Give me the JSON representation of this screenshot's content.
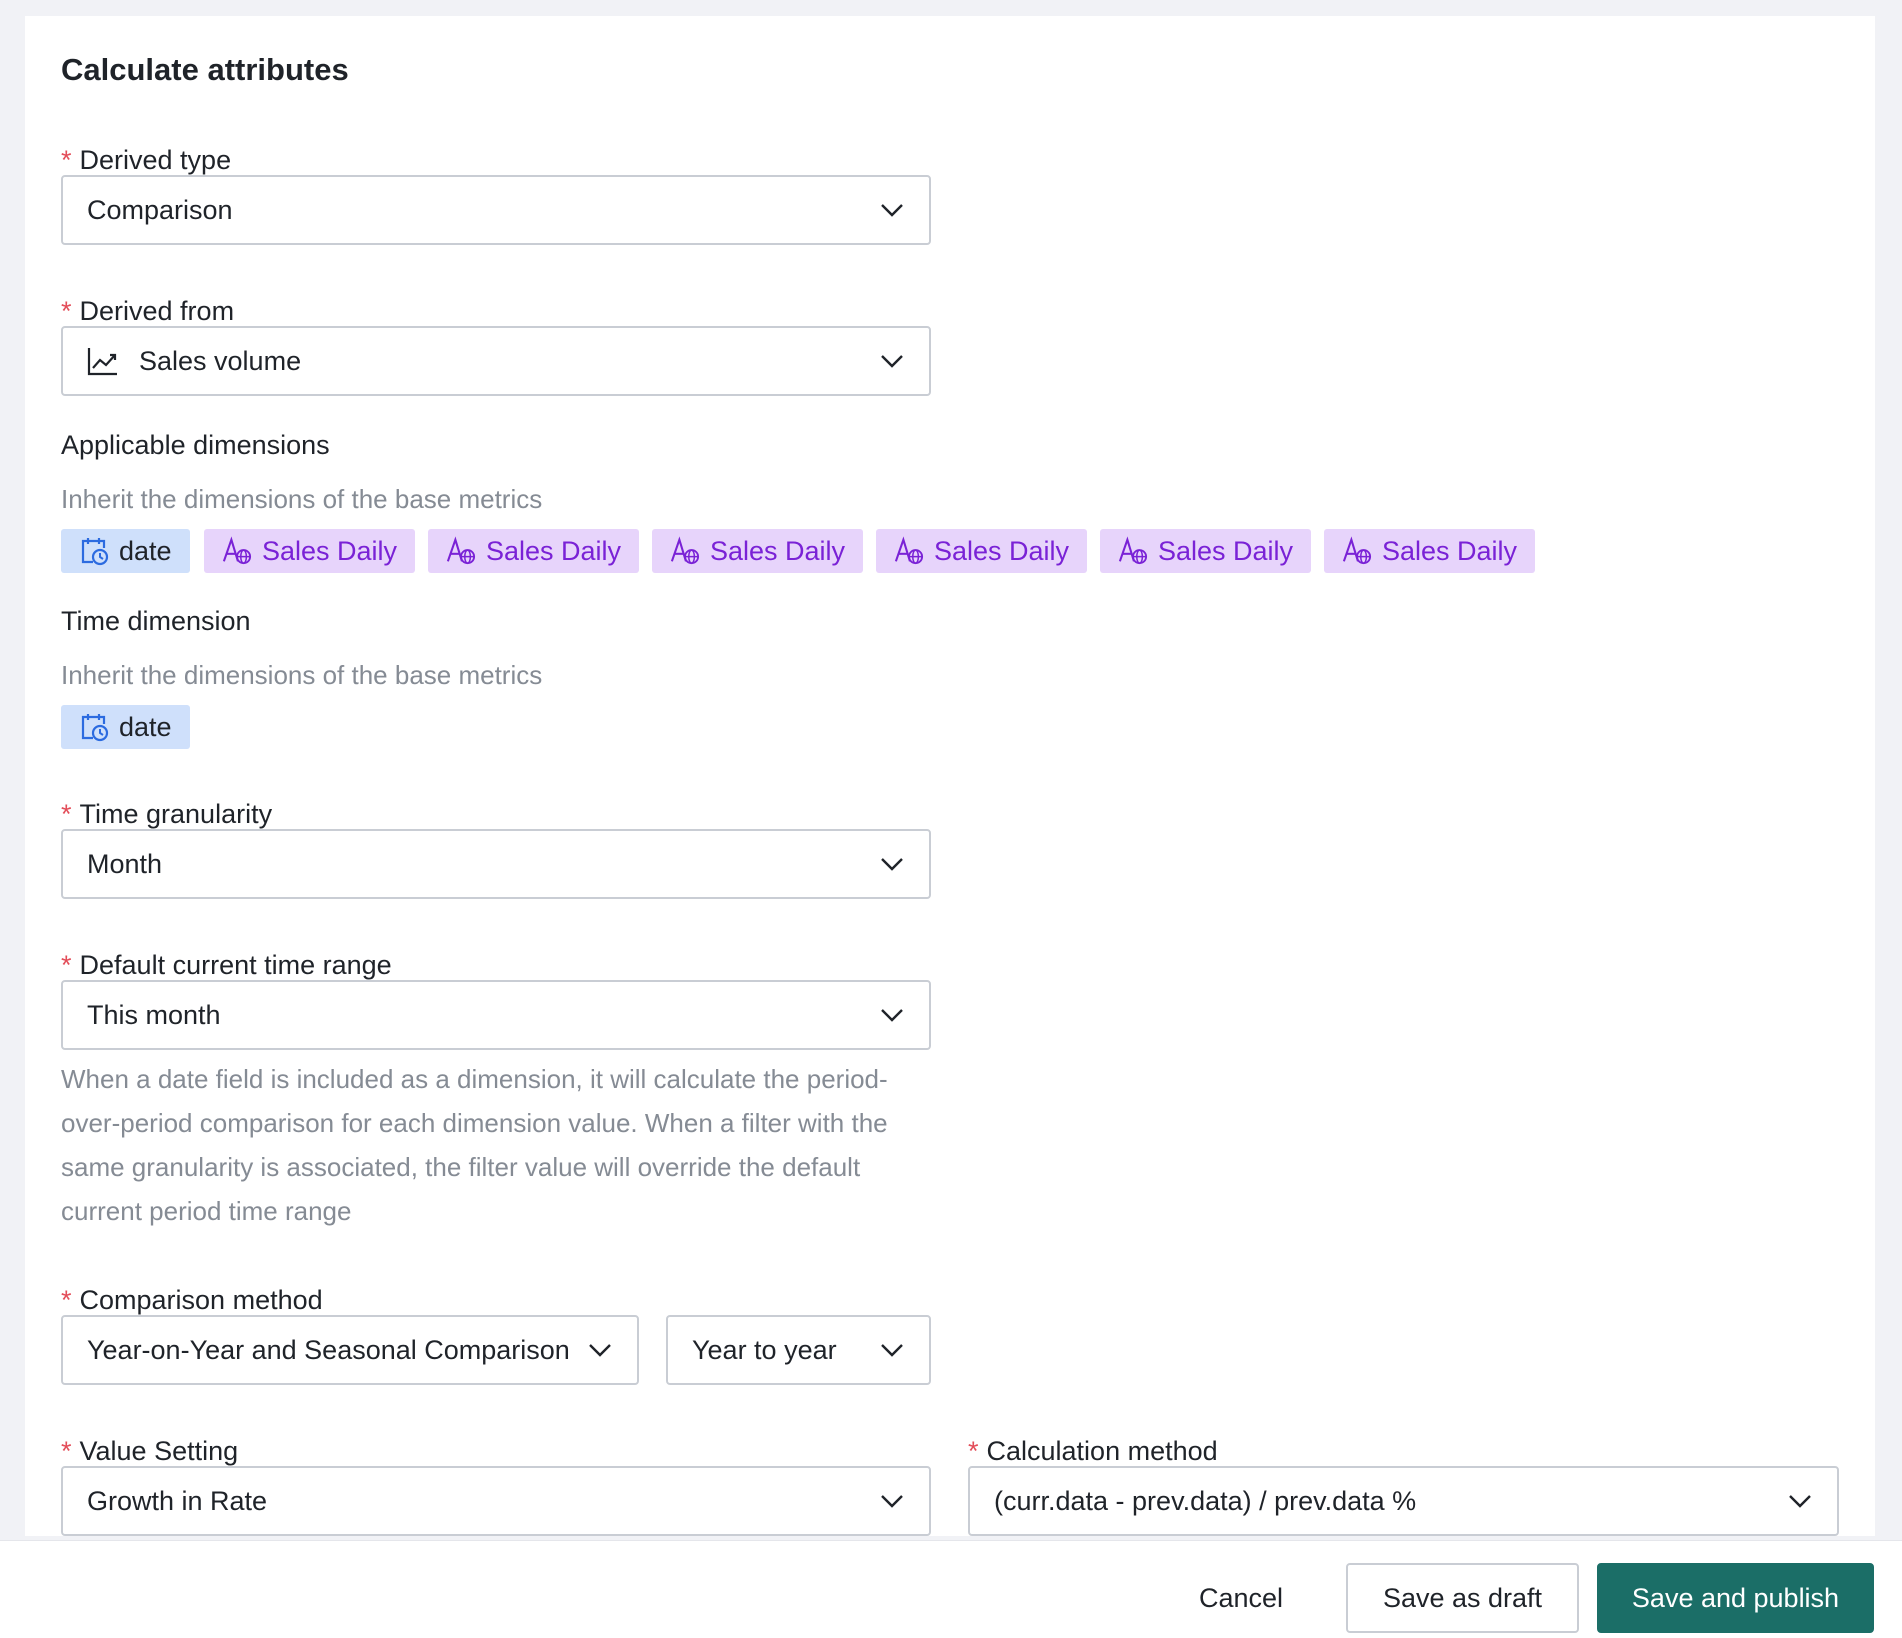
{
  "panel": {
    "title": "Calculate attributes"
  },
  "fields": {
    "derived_type": {
      "label": "Derived type",
      "value": "Comparison"
    },
    "derived_from": {
      "label": "Derived from",
      "value": "Sales volume",
      "icon": "line-chart-icon"
    },
    "applicable_dimensions": {
      "label": "Applicable dimensions",
      "hint": "Inherit the dimensions of the base metrics",
      "tags": [
        {
          "label": "date",
          "icon": "calendar-clock-icon",
          "kind": "date"
        },
        {
          "label": "Sales Daily",
          "icon": "text-global-icon",
          "kind": "attr"
        },
        {
          "label": "Sales Daily",
          "icon": "text-global-icon",
          "kind": "attr"
        },
        {
          "label": "Sales Daily",
          "icon": "text-global-icon",
          "kind": "attr"
        },
        {
          "label": "Sales Daily",
          "icon": "text-global-icon",
          "kind": "attr"
        },
        {
          "label": "Sales Daily",
          "icon": "text-global-icon",
          "kind": "attr"
        },
        {
          "label": "Sales Daily",
          "icon": "text-global-icon",
          "kind": "attr"
        }
      ]
    },
    "time_dimension": {
      "label": "Time dimension",
      "hint": "Inherit the dimensions of the base metrics",
      "tag": {
        "label": "date",
        "icon": "calendar-clock-icon"
      }
    },
    "time_granularity": {
      "label": "Time granularity",
      "value": "Month"
    },
    "default_time_range": {
      "label": "Default current time range",
      "value": "This month",
      "help": "When a date field is included as a dimension, it will calculate the period-over-period comparison for each dimension value. When a filter with the same granularity is associated, the filter value will override the default current period time range"
    },
    "comparison_method": {
      "label": "Comparison method",
      "method_value": "Year-on-Year and Seasonal Comparison",
      "period_value": "Year to year"
    },
    "value_setting": {
      "label": "Value Setting",
      "value": "Growth in Rate"
    },
    "calculation_method": {
      "label": "Calculation method",
      "value": "(curr.data - prev.data) / prev.data %"
    }
  },
  "footer": {
    "cancel_label": "Cancel",
    "draft_label": "Save as draft",
    "publish_label": "Save and publish"
  },
  "colors": {
    "required": "#e34d59",
    "primary": "#1b6e67",
    "date_tag_bg": "#cfe0fb",
    "attr_tag_bg": "#e7d4fb",
    "attr_tag_text": "#7a22d6"
  }
}
